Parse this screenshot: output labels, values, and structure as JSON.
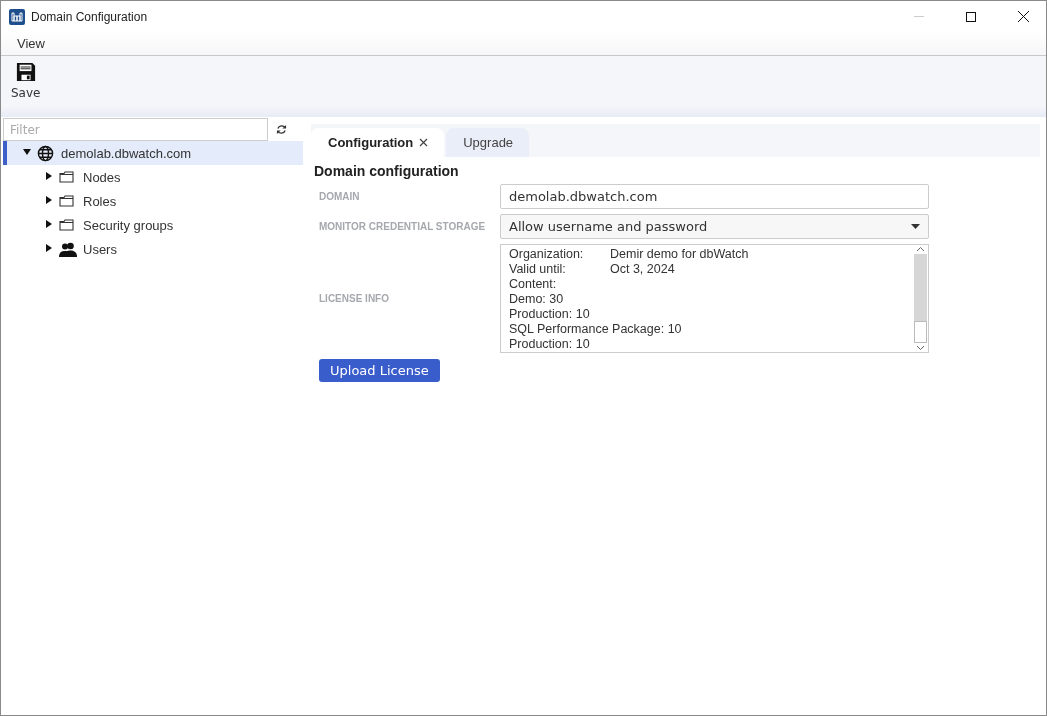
{
  "window": {
    "title": "Domain Configuration",
    "minimize_disabled": true
  },
  "menu": [
    "View"
  ],
  "toolbar": [
    {
      "label": "Save",
      "kind": "save"
    }
  ],
  "filter": {
    "placeholder": "Filter"
  },
  "tree": [
    {
      "label": "demolab.dbwatch.com",
      "kind": "domain",
      "expanded": true,
      "selected": true,
      "children": [
        {
          "label": "Nodes",
          "kind": "folder",
          "expanded": false,
          "selected": false
        },
        {
          "label": "Roles",
          "kind": "folder",
          "expanded": false,
          "selected": false
        },
        {
          "label": "Security groups",
          "kind": "folder",
          "expanded": false,
          "selected": false
        },
        {
          "label": "Users",
          "kind": "users",
          "expanded": false,
          "selected": false
        }
      ]
    }
  ],
  "tabs": [
    {
      "label": "Configuration",
      "selected": true,
      "closable": true
    },
    {
      "label": "Upgrade",
      "selected": false,
      "closable": false
    }
  ],
  "form": {
    "title": "Domain configuration",
    "fields": [
      {
        "label": "DOMAIN",
        "kind": "text",
        "value": "demolab.dbwatch.com"
      },
      {
        "label": "MONITOR CREDENTIAL STORAGE",
        "kind": "select",
        "value": "Allow username and password"
      },
      {
        "label": "LICENSE INFO",
        "kind": "textarea",
        "lines": [
          {
            "label": "Organization:",
            "value": "Demir demo for dbWatch"
          },
          {
            "label": "Valid until:",
            "value": "Oct 3, 2024"
          },
          {
            "label": "Content:"
          },
          {
            "label": "Demo: 30"
          },
          {
            "label": "Production: 10"
          },
          {
            "label": "SQL Performance Package: 10"
          },
          {
            "label": "Production: 10"
          }
        ]
      }
    ],
    "button": "Upload License"
  }
}
